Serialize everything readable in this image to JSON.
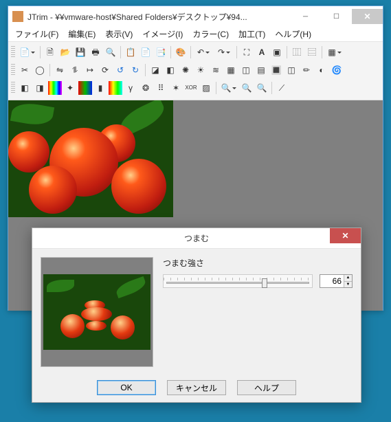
{
  "main": {
    "title": "JTrim - ¥¥vmware-host¥Shared Folders¥デスクトップ¥94...",
    "menu": {
      "file": "ファイル(F)",
      "edit": "編集(E)",
      "view": "表示(V)",
      "image": "イメージ(I)",
      "color": "カラー(C)",
      "process": "加工(T)",
      "help": "ヘルプ(H)"
    }
  },
  "dialog": {
    "title": "つまむ",
    "strength_label": "つまむ強さ",
    "value": "66",
    "ok": "OK",
    "cancel": "キャンセル",
    "help": "ヘルプ"
  }
}
